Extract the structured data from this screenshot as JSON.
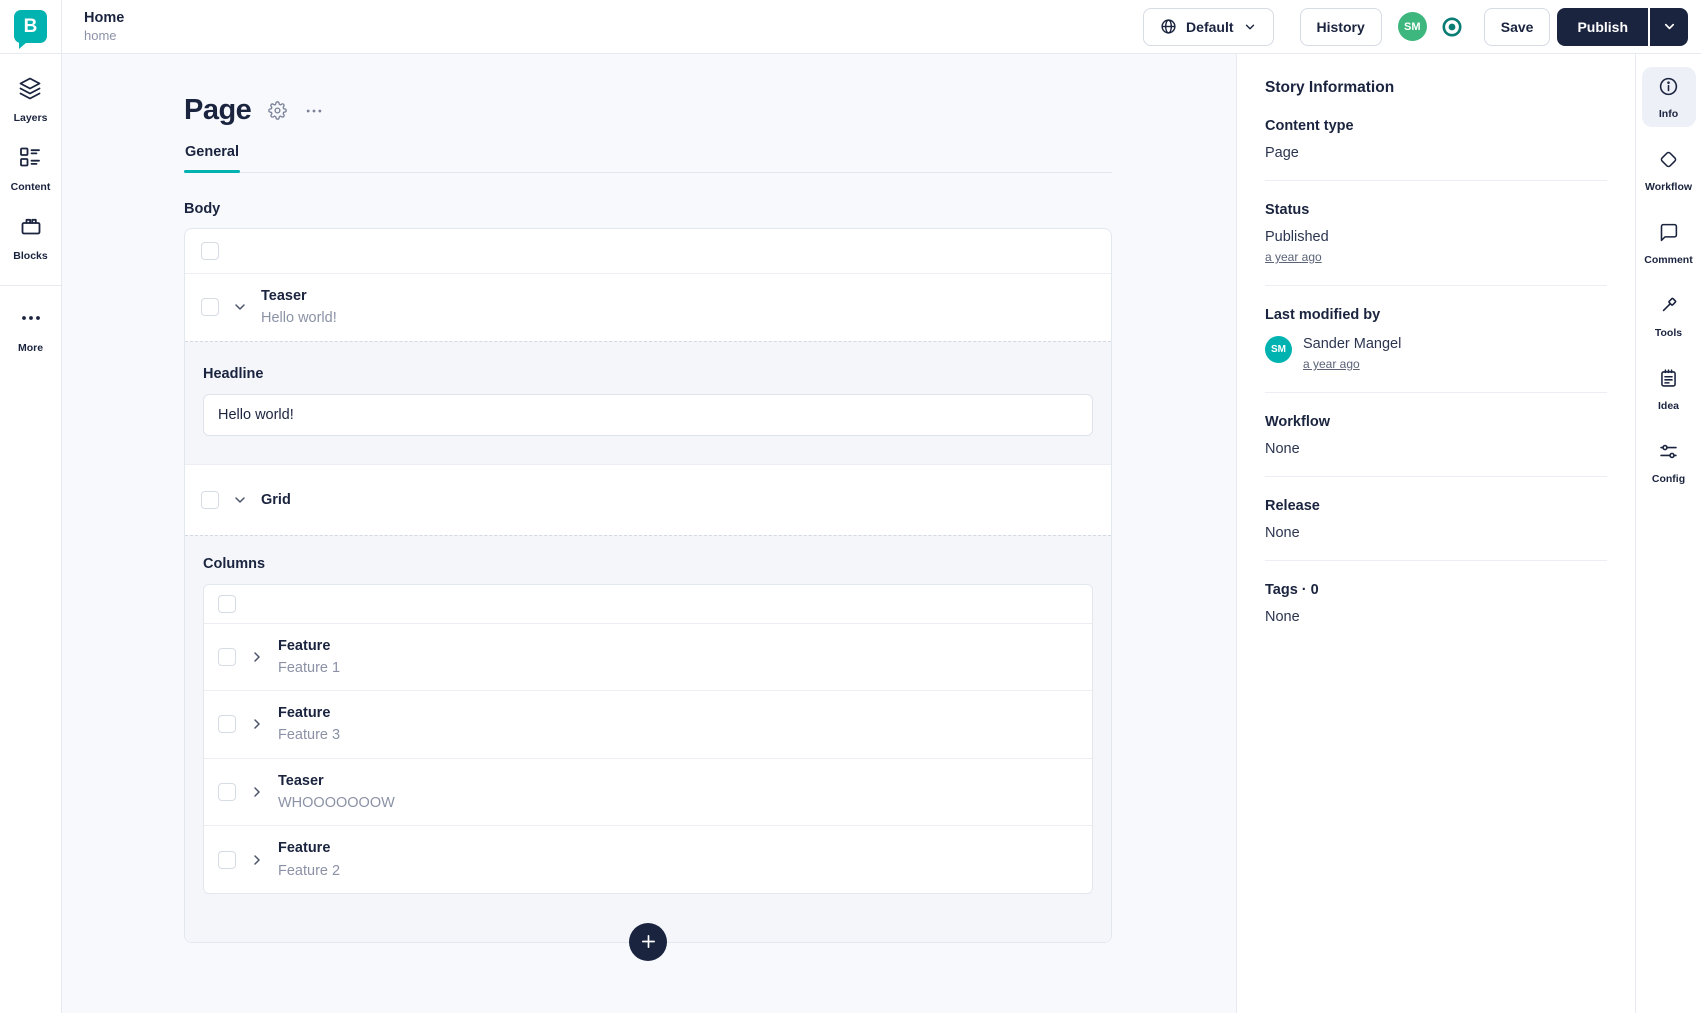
{
  "header": {
    "story_title": "Home",
    "story_slug": "home",
    "language_selector": "Default",
    "history_button": "History",
    "user_avatar_initials": "SM",
    "save_button": "Save",
    "publish_button": "Publish"
  },
  "left_rail": {
    "items": [
      {
        "label": "Layers"
      },
      {
        "label": "Content"
      },
      {
        "label": "Blocks"
      },
      {
        "label": "More"
      }
    ]
  },
  "editor": {
    "content_type_title": "Page",
    "active_tab": "General",
    "body_field": {
      "label": "Body",
      "teaser_block": {
        "name": "Teaser",
        "preview": "Hello world!"
      },
      "headline_field": {
        "label": "Headline",
        "value": "Hello world!"
      },
      "grid_block": {
        "name": "Grid"
      },
      "columns_field": {
        "label": "Columns",
        "items": [
          {
            "name": "Feature",
            "preview": "Feature 1"
          },
          {
            "name": "Feature",
            "preview": "Feature 3"
          },
          {
            "name": "Teaser",
            "preview": "WHOOOOOOOW"
          },
          {
            "name": "Feature",
            "preview": "Feature 2"
          }
        ]
      }
    }
  },
  "story_info": {
    "title": "Story Information",
    "content_type": {
      "label": "Content type",
      "value": "Page"
    },
    "status": {
      "label": "Status",
      "value": "Published",
      "time_link": "a year ago"
    },
    "last_modified": {
      "label": "Last modified by",
      "user": "Sander Mangel",
      "avatar_initials": "SM",
      "time_link": "a year ago"
    },
    "workflow": {
      "label": "Workflow",
      "value": "None"
    },
    "release": {
      "label": "Release",
      "value": "None"
    },
    "tags": {
      "label": "Tags · 0",
      "value": "None"
    }
  },
  "right_rail": {
    "items": [
      {
        "label": "Info"
      },
      {
        "label": "Workflow"
      },
      {
        "label": "Comment"
      },
      {
        "label": "Tools"
      },
      {
        "label": "Idea"
      },
      {
        "label": "Config"
      }
    ]
  },
  "colors": {
    "brand_teal": "#00b3b0",
    "navy": "#1b243f",
    "header_avatar_green": "#3eb77e",
    "presence_icon_teal": "#0a7d75",
    "active_tab_underline": "#00b3b0",
    "active_rail_item_bg": "#eef0f8"
  }
}
